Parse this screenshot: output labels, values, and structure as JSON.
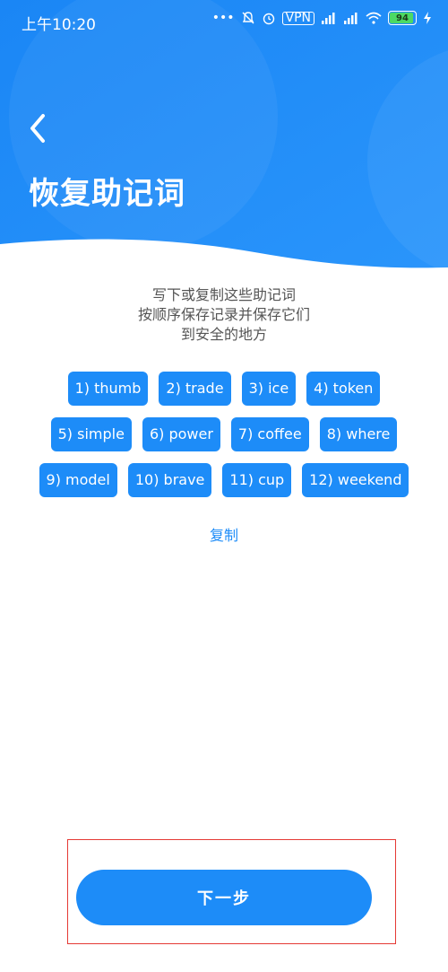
{
  "status_bar": {
    "time": "上午10:20",
    "vpn_label": "VPN",
    "battery_percent": "94",
    "battery_level": 0.94
  },
  "header": {
    "title": "恢复助记词",
    "background_color": "#1d8cf8"
  },
  "instructions": {
    "line1": "写下或复制这些助记词",
    "line2": "按顺序保存记录并保存它们",
    "line3": "到安全的地方"
  },
  "mnemonic_words": [
    "1) thumb",
    "2) trade",
    "3) ice",
    "4) token",
    "5) simple",
    "6) power",
    "7) coffee",
    "8) where",
    "9) model",
    "10) brave",
    "11) cup",
    "12) weekend"
  ],
  "copy_label": "复制",
  "next_button_label": "下一步",
  "colors": {
    "accent": "#1d8cf8",
    "highlight_border": "#e53935",
    "text_gray": "#555555"
  }
}
